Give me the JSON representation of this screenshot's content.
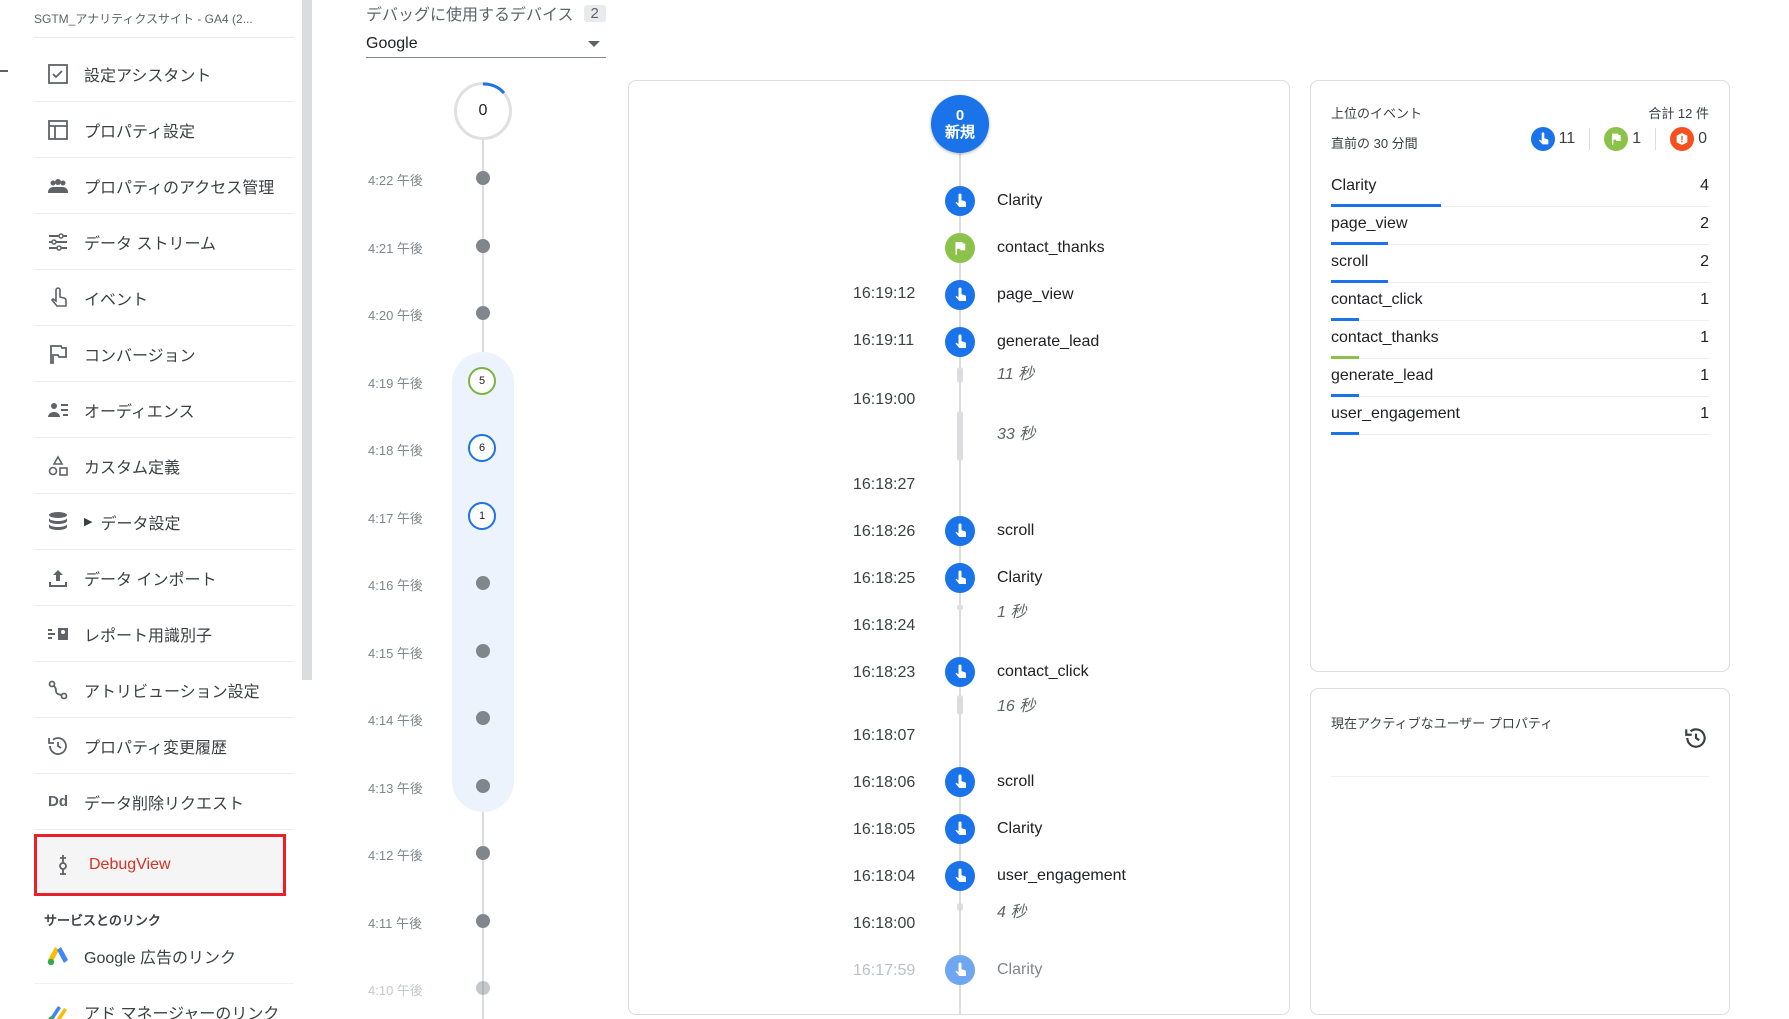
{
  "sidebar": {
    "property_name": "SGTM_アナリティクスサイト - GA4 (2...",
    "items": [
      {
        "label": "設定アシスタント",
        "icon": "checklist-icon"
      },
      {
        "label": "プロパティ設定",
        "icon": "property-icon"
      },
      {
        "label": "プロパティのアクセス管理",
        "icon": "people-icon"
      },
      {
        "label": "データ ストリーム",
        "icon": "streams-icon"
      },
      {
        "label": "イベント",
        "icon": "touch-icon"
      },
      {
        "label": "コンバージョン",
        "icon": "flag-icon"
      },
      {
        "label": "オーディエンス",
        "icon": "audience-icon"
      },
      {
        "label": "カスタム定義",
        "icon": "shapes-icon"
      },
      {
        "label": "データ設定",
        "icon": "database-icon"
      },
      {
        "label": "データ インポート",
        "icon": "upload-icon"
      },
      {
        "label": "レポート用識別子",
        "icon": "identity-icon"
      },
      {
        "label": "アトリビューション設定",
        "icon": "attribution-icon"
      },
      {
        "label": "プロパティ変更履歴",
        "icon": "history-icon"
      },
      {
        "label": "データ削除リクエスト",
        "icon": "dd-icon"
      },
      {
        "label": "DebugView",
        "icon": "debug-icon"
      }
    ],
    "dd_text": "Dd",
    "section_label": "サービスとのリンク",
    "links": [
      {
        "label": "Google 広告のリンク",
        "icon": "google-ads-icon"
      },
      {
        "label": "アド マネージャーのリンク",
        "icon": "ad-manager-icon"
      }
    ]
  },
  "device": {
    "label": "デバッグに使用するデバイス",
    "count": "2",
    "selected": "Google"
  },
  "minutes": {
    "top_count": "0",
    "rows": [
      {
        "time": "4:22 午後",
        "count": ""
      },
      {
        "time": "4:21 午後",
        "count": ""
      },
      {
        "time": "4:20 午後",
        "count": ""
      },
      {
        "time": "4:19 午後",
        "count": "5"
      },
      {
        "time": "4:18 午後",
        "count": "6"
      },
      {
        "time": "4:17 午後",
        "count": "1"
      },
      {
        "time": "4:16 午後",
        "count": ""
      },
      {
        "time": "4:15 午後",
        "count": ""
      },
      {
        "time": "4:14 午後",
        "count": ""
      },
      {
        "time": "4:13 午後",
        "count": ""
      },
      {
        "time": "4:12 午後",
        "count": ""
      },
      {
        "time": "4:11 午後",
        "count": ""
      },
      {
        "time": "4:10 午後",
        "count": ""
      }
    ]
  },
  "seconds": {
    "new_count": "0",
    "new_label": "新規",
    "events": [
      {
        "name": "Clarity",
        "kind": "blue"
      },
      {
        "name": "contact_thanks",
        "kind": "green"
      },
      {
        "name": "page_view",
        "kind": "blue"
      },
      {
        "name": "generate_lead",
        "kind": "blue"
      },
      {
        "name": "scroll",
        "kind": "blue"
      },
      {
        "name": "Clarity",
        "kind": "blue"
      },
      {
        "name": "contact_click",
        "kind": "blue"
      },
      {
        "name": "scroll",
        "kind": "blue"
      },
      {
        "name": "Clarity",
        "kind": "blue"
      },
      {
        "name": "user_engagement",
        "kind": "blue"
      },
      {
        "name": "Clarity",
        "kind": "faded"
      }
    ],
    "timestamps": [
      "16:19:12",
      "16:19:11",
      "16:19:00",
      "16:18:27",
      "16:18:26",
      "16:18:25",
      "16:18:24",
      "16:18:23",
      "16:18:07",
      "16:18:06",
      "16:18:05",
      "16:18:04",
      "16:18:00",
      "16:17:59"
    ],
    "gaps": [
      "11 秒",
      "33 秒",
      "1 秒",
      "16 秒",
      "4 秒"
    ]
  },
  "top_events": {
    "title": "上位のイベント",
    "total": "合計 12 件",
    "subtitle": "直前の 30 分間",
    "count_blue": "11",
    "count_green": "1",
    "count_orange": "0",
    "rows": [
      {
        "name": "Clarity",
        "value": "4",
        "share": 0.29,
        "kind": "blue"
      },
      {
        "name": "page_view",
        "value": "2",
        "share": 0.15,
        "kind": "blue"
      },
      {
        "name": "scroll",
        "value": "2",
        "share": 0.15,
        "kind": "blue"
      },
      {
        "name": "contact_click",
        "value": "1",
        "share": 0.075,
        "kind": "blue"
      },
      {
        "name": "contact_thanks",
        "value": "1",
        "share": 0.075,
        "kind": "green"
      },
      {
        "name": "generate_lead",
        "value": "1",
        "share": 0.075,
        "kind": "blue"
      },
      {
        "name": "user_engagement",
        "value": "1",
        "share": 0.075,
        "kind": "blue"
      }
    ]
  },
  "user_props": {
    "title": "現在アクティブなユーザー プロパティ"
  }
}
